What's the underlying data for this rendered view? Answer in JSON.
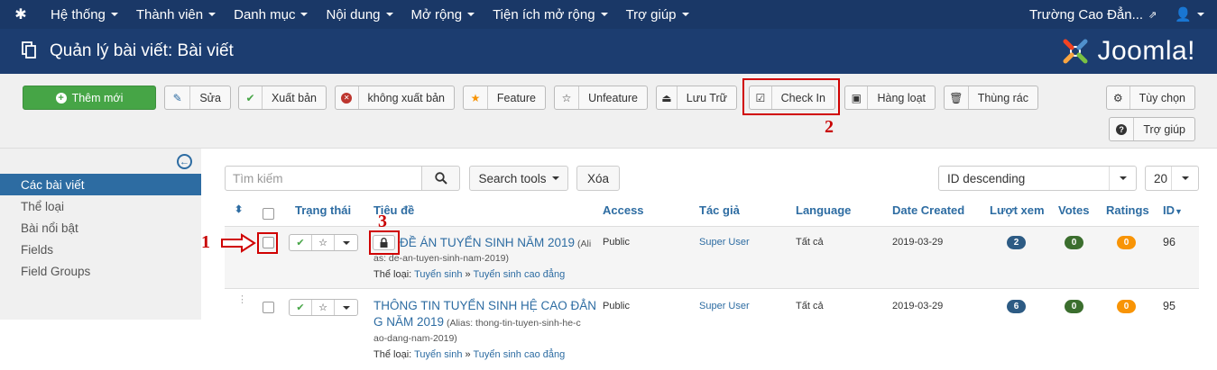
{
  "nav": {
    "items": [
      "Hệ thống",
      "Thành viên",
      "Danh mục",
      "Nội dung",
      "Mở rộng",
      "Tiện ích mở rộng",
      "Trợ giúp"
    ],
    "site_name": "Trường Cao Đẳn..."
  },
  "header": {
    "title": "Quản lý bài viết: Bài viết",
    "logo_text": "Joomla!"
  },
  "toolbar": {
    "new": "Thêm mới",
    "edit": "Sửa",
    "publish": "Xuất bản",
    "unpublish": "không xuất bản",
    "feature": "Feature",
    "unfeature": "Unfeature",
    "archive": "Lưu Trữ",
    "checkin": "Check In",
    "batch": "Hàng loạt",
    "trash": "Thùng rác",
    "options": "Tùy chọn",
    "help": "Trợ giúp"
  },
  "sidebar": {
    "items": [
      "Các bài viết",
      "Thể loại",
      "Bài nổi bật",
      "Fields",
      "Field Groups"
    ]
  },
  "filters": {
    "search_placeholder": "Tìm kiếm",
    "search_tools": "Search tools",
    "clear": "Xóa",
    "ordering": "ID descending",
    "limit": "20"
  },
  "table": {
    "headers": {
      "status": "Trạng thái",
      "title": "Tiêu đề",
      "access": "Access",
      "author": "Tác giả",
      "language": "Language",
      "date": "Date Created",
      "hits": "Lượt xem",
      "votes": "Votes",
      "ratings": "Ratings",
      "id": "ID"
    },
    "rows": [
      {
        "title_a": "ĐỀ ÁN TUYỂN SINH NĂM 2019",
        "alias_a": " (Ali",
        "alias_b": "as: de-an-tuyen-sinh-nam-2019)",
        "cat_label": "Thể loại:",
        "cat_parent": "Tuyển sinh",
        "cat_sep": " » ",
        "cat_child": "Tuyển sinh cao đẳng",
        "access": "Public",
        "author": "Super User",
        "language": "Tất cả",
        "date": "2019-03-29",
        "hits": "2",
        "votes": "0",
        "ratings": "0",
        "id": "96"
      },
      {
        "title_a": "THÔNG TIN TUYỂN SINH HỆ CAO ĐẲN",
        "title_b": "G NĂM 2019",
        "alias_a": " (Alias: thong-tin-tuyen-sinh-he-c",
        "alias_b": "ao-dang-nam-2019)",
        "cat_label": "Thể loại:",
        "cat_parent": "Tuyển sinh",
        "cat_sep": " » ",
        "cat_child": "Tuyển sinh cao đẳng",
        "access": "Public",
        "author": "Super User",
        "language": "Tất cả",
        "date": "2019-03-29",
        "hits": "6",
        "votes": "0",
        "ratings": "0",
        "id": "95"
      }
    ]
  },
  "annotations": {
    "n1": "1",
    "n2": "2",
    "n3": "3"
  },
  "colors": {
    "nav_bg": "#1a3867",
    "header_bg": "#1c3d70",
    "accent": "#2d6ca2",
    "green": "#46a546",
    "hits_badge": "#2d5b84",
    "votes_badge": "#3b6e2e",
    "ratings_badge": "#f89406",
    "annotation_red": "#d00000"
  }
}
